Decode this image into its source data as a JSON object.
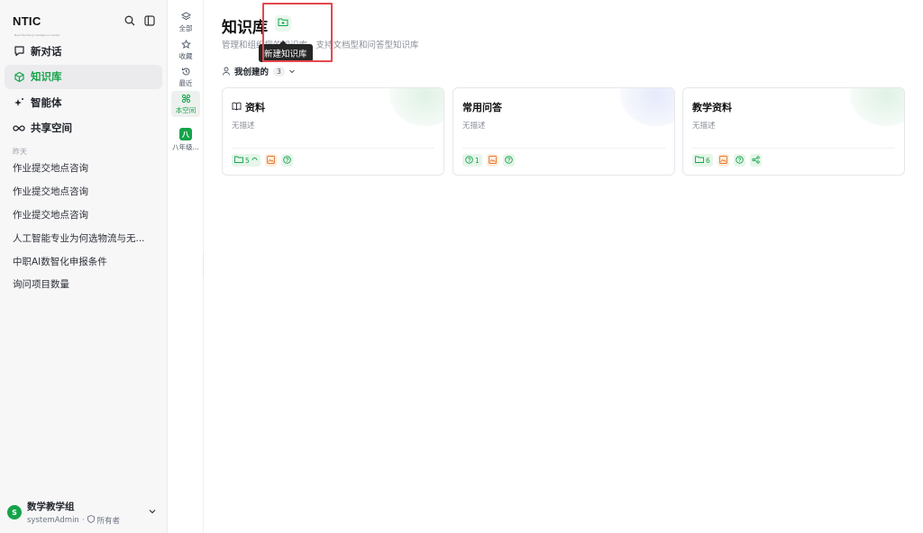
{
  "brand": {
    "logo": "NTIC",
    "tagline": "Next Teaching Intelligence Center"
  },
  "sidebar": {
    "nav": [
      {
        "label": "新对话",
        "icon": "chat-icon"
      },
      {
        "label": "知识库",
        "icon": "knowledge-cube-icon",
        "active": true
      },
      {
        "label": "智能体",
        "icon": "sparkle-icon"
      },
      {
        "label": "共享空间",
        "icon": "infinity-icon"
      }
    ],
    "history_label": "昨天",
    "history": [
      "作业提交地点咨询",
      "作业提交地点咨询",
      "作业提交地点咨询",
      "人工智能专业为何选物流与无...",
      "中职AI数智化申报条件",
      "询问项目数量"
    ],
    "user": {
      "initial": "S",
      "name": "数学教学组",
      "account": "systemAdmin",
      "separator": "·",
      "role": "所有者"
    }
  },
  "rail": [
    {
      "label": "全部",
      "icon": "layers-icon"
    },
    {
      "label": "收藏",
      "icon": "star-icon"
    },
    {
      "label": "最近",
      "icon": "history-icon"
    },
    {
      "label": "本空间",
      "icon": "network-icon",
      "active": true
    },
    {
      "label": "八年级...",
      "badge": "八"
    }
  ],
  "main": {
    "title": "知识库",
    "subtitle": "管理和组织您的知识库，支持文档型和问答型知识库",
    "tooltip": "新建知识库",
    "filter_label": "我创建的",
    "filter_count": "3",
    "cards": [
      {
        "title": "资料",
        "desc": "无描述",
        "tag_count": "5",
        "theme": "green"
      },
      {
        "title": "常用问答",
        "desc": "无描述",
        "tag_count": "1",
        "theme": "blue"
      },
      {
        "title": "教学资料",
        "desc": "无描述",
        "tag_count": "6",
        "theme": "green"
      }
    ]
  },
  "colors": {
    "accent": "#16a34a",
    "highlight": "#e5484d",
    "orange": "#e5772b"
  }
}
